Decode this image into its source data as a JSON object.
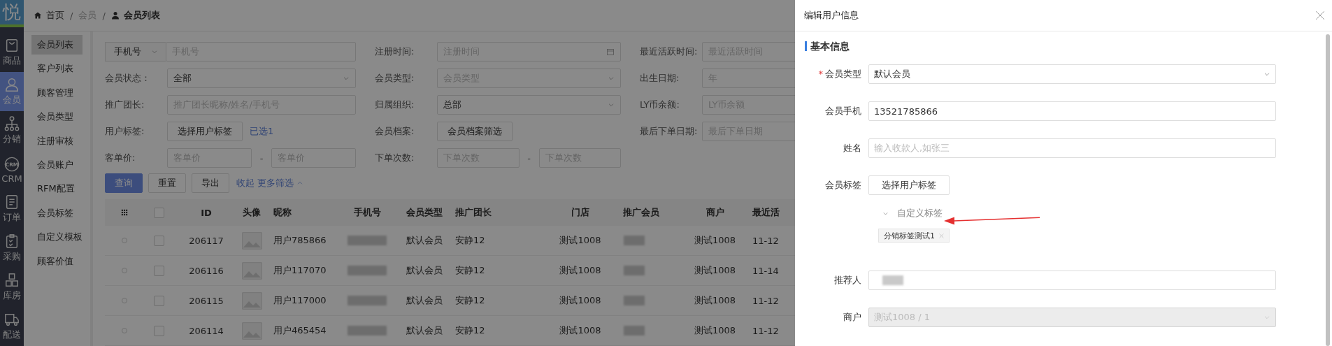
{
  "nav": {
    "logo": "悦",
    "items": [
      {
        "label": "商品",
        "kind": "bag",
        "selected": false
      },
      {
        "label": "会员",
        "kind": "person",
        "selected": true
      },
      {
        "label": "分销",
        "kind": "tree",
        "selected": false
      },
      {
        "label": "CRM",
        "kind": "badge",
        "badge": "CRM",
        "selected": false
      },
      {
        "label": "订单",
        "kind": "doc",
        "selected": false
      },
      {
        "label": "采购",
        "kind": "clipboard",
        "selected": false
      },
      {
        "label": "库房",
        "kind": "blocks",
        "selected": false
      },
      {
        "label": "配送",
        "kind": "truck",
        "selected": false
      }
    ]
  },
  "breadcrumb": [
    {
      "label": "首页",
      "kind": "home",
      "current": false
    },
    {
      "separator": "/",
      "label": "会员",
      "kind": "text",
      "current": false
    },
    {
      "separator": "/",
      "label": "会员列表",
      "kind": "user",
      "current": true
    }
  ],
  "submenu": [
    {
      "label": "会员列表",
      "selected": true
    },
    {
      "label": "客户列表",
      "selected": false
    },
    {
      "label": "顾客管理",
      "selected": false
    },
    {
      "label": "会员类型",
      "selected": false
    },
    {
      "label": "注册审核",
      "selected": false
    },
    {
      "label": "会员账户",
      "selected": false
    },
    {
      "label": "RFM配置",
      "selected": false
    },
    {
      "label": "会员标签",
      "selected": false
    },
    {
      "label": "自定义模板",
      "selected": false
    },
    {
      "label": "顾客价值",
      "selected": false
    }
  ],
  "filters": [
    {
      "kind": "keyword",
      "select": "手机号",
      "placeholder": "手机号"
    },
    {
      "kind": "date",
      "label": "注册时间:",
      "placeholder": "注册时间"
    },
    {
      "kind": "input",
      "label": "最近活跃时间:",
      "placeholder": "最近活跃时间"
    },
    {
      "kind": "select",
      "label": "会员状态：",
      "value": "全部"
    },
    {
      "kind": "select",
      "label": "会员类型:",
      "placeholder": "会员类型"
    },
    {
      "kind": "date",
      "label": "出生日期:",
      "placeholder": "年"
    },
    {
      "kind": "input",
      "label": "推广团长:",
      "placeholder": "推广团长昵称/姓名/手机号"
    },
    {
      "kind": "select",
      "label": "归属组织:",
      "value": "总部"
    },
    {
      "kind": "input",
      "label": "LY币余额:",
      "placeholder": "LY币余额"
    },
    {
      "kind": "button",
      "label": "用户标签:",
      "button": "选择用户标签",
      "note": "已选1"
    },
    {
      "kind": "button",
      "label": "会员档案:",
      "button": "会员档案筛选"
    },
    {
      "kind": "input",
      "label": "最后下单日期:",
      "placeholder": "最后下单日期"
    },
    {
      "kind": "range",
      "label": "客单价:",
      "from": "客单价",
      "separator": "-",
      "to": "客单价"
    },
    {
      "kind": "range",
      "label": "下单次数:",
      "from": "下单次数",
      "separator": "-",
      "to": "下单次数"
    }
  ],
  "actions": [
    {
      "label": "查询",
      "kind": "primary"
    },
    {
      "label": "重置",
      "kind": "default"
    },
    {
      "label": "导出",
      "kind": "default"
    }
  ],
  "filter_toggle": "收起 更多筛选",
  "table": {
    "all_checked": false,
    "columns": [
      "ID",
      "头像",
      "昵称",
      "手机号",
      "会员类型",
      "推广团长",
      "门店",
      "推广会员",
      "商户",
      "最近活"
    ],
    "rows": [
      {
        "selected": false,
        "checked": false,
        "id": "206117",
        "nickname": "用户785866",
        "type": "默认会员",
        "leader": "安静12",
        "store": "测试1008",
        "merchant": "测试1008",
        "active": "11-12"
      },
      {
        "selected": false,
        "checked": false,
        "id": "206116",
        "nickname": "用户117070",
        "type": "默认会员",
        "leader": "安静12",
        "store": "测试1008",
        "merchant": "测试1008",
        "active": "11-14"
      },
      {
        "selected": false,
        "checked": false,
        "id": "206115",
        "nickname": "用户117000",
        "type": "默认会员",
        "leader": "安静12",
        "store": "测试1008",
        "merchant": "测试1008",
        "active": "11-12"
      },
      {
        "selected": false,
        "checked": false,
        "id": "206114",
        "nickname": "用户465454",
        "type": "默认会员",
        "leader": "安静12",
        "store": "测试1008",
        "merchant": "测试1008",
        "active": "11-12"
      }
    ]
  },
  "drawer": {
    "title": "编辑用户信息",
    "section": "基本信息",
    "fields": [
      {
        "kind": "select",
        "label": "会员类型",
        "required_mark": "*",
        "value": "默认会员",
        "disabled": false
      },
      {
        "kind": "input",
        "label": "会员手机",
        "value": "13521785866",
        "disabled": false
      },
      {
        "kind": "input",
        "label": "姓名",
        "placeholder": "输入收款人,如张三",
        "disabled": false
      },
      {
        "kind": "tags",
        "label": "会员标签",
        "button": "选择用户标签",
        "group": {
          "label": "自定义标签",
          "expanded": true,
          "tags": [
            "分销标签测试1"
          ]
        }
      },
      {
        "kind": "redacted",
        "label": "推荐人",
        "disabled": false
      },
      {
        "kind": "select",
        "label": "商户",
        "value": "测试1008 / 1",
        "disabled": true
      }
    ]
  }
}
